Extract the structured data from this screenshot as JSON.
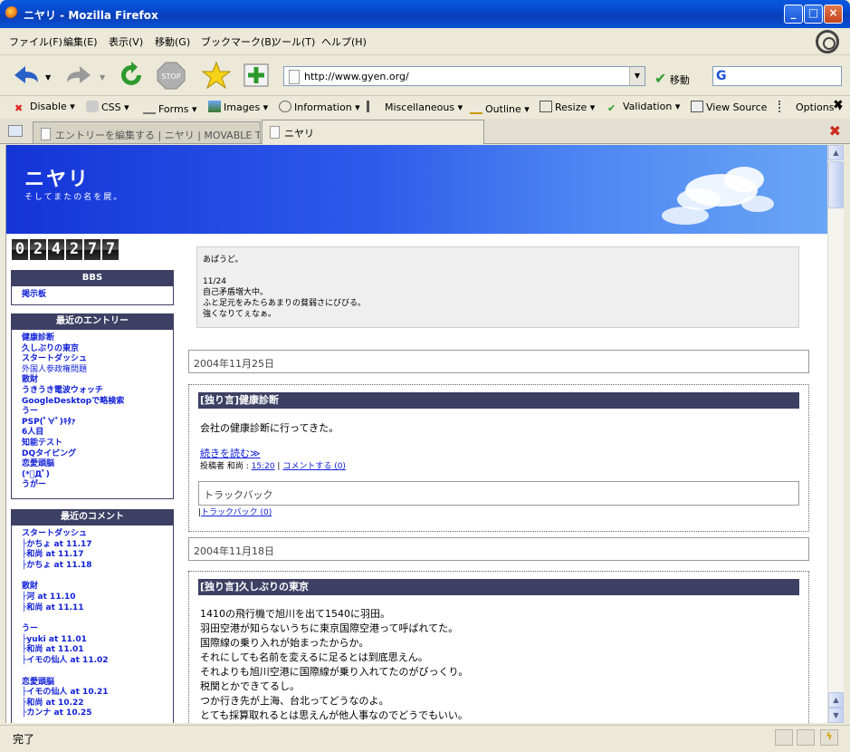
{
  "window": {
    "title": "ニヤリ - Mozilla Firefox"
  },
  "menu": [
    "ファイル(F)",
    "編集(E)",
    "表示(V)",
    "移動(G)",
    "ブックマーク(B)",
    "ツール(T)",
    "ヘルプ(H)"
  ],
  "nav": {
    "url": "http://www.gyen.org/",
    "go_label": "移動",
    "search_value": ""
  },
  "devbar": [
    "Disable",
    "CSS",
    "Forms",
    "Images",
    "Information",
    "Miscellaneous",
    "Outline",
    "Resize",
    "Validation",
    "View Source",
    "Options"
  ],
  "tabs": [
    {
      "label": "エントリーを編集する | ニヤリ | MOVABLE T..."
    },
    {
      "label": "ニヤリ"
    }
  ],
  "blog": {
    "title": "ニヤリ",
    "subtitle": "そしてまたの名を屍。",
    "counter": [
      "0",
      "2",
      "4",
      "2",
      "7",
      "7"
    ]
  },
  "sidebar": {
    "bbs": {
      "header": "BBS",
      "items": [
        "掲示板"
      ]
    },
    "recent_entries": {
      "header": "最近のエントリー",
      "items": [
        "健康診断",
        "久しぶりの東京",
        "スタートダッシュ",
        "外国人参政権問題",
        "散財",
        "うきうき電波ウォッチ",
        "GoogleDesktopで略検索",
        "うー",
        "PSP(ﾟ∀ﾟ)ｷﾀｧ",
        "6人目",
        "知能テスト",
        "DQタイピング",
        "恋愛頭脳",
        "(*ﾟДﾟ)",
        "うがー"
      ]
    },
    "recent_comments": {
      "header": "最近のコメント",
      "groups": [
        {
          "title": "スタートダッシュ",
          "items": [
            "├かちょ at 11.17",
            "├和尚 at 11.17",
            "├かちょ at 11.18"
          ]
        },
        {
          "title": "散財",
          "items": [
            "├河 at 11.10",
            "├和尚 at 11.11"
          ]
        },
        {
          "title": "うー",
          "items": [
            "├yuki at 11.01",
            "├和尚 at 11.01",
            "├イモの仙人 at 11.02"
          ]
        },
        {
          "title": "恋愛頭脳",
          "items": [
            "├イモの仙人 at 10.21",
            "├和尚 at 10.22",
            "├カンナ at 10.25"
          ]
        }
      ]
    }
  },
  "intro": {
    "lines": [
      "あぱうど。",
      "",
      "11/24",
      "自己矛盾増大中。",
      "ふと足元をみたらあまりの貧弱さにびびる。",
      "強くなりてぇなぁ。"
    ]
  },
  "main": {
    "date1": "2004年11月25日",
    "entry1": {
      "title": "[独り言]健康診断",
      "body": "会社の健康診断に行ってきた。",
      "more": "続きを読む≫",
      "meta_prefix": "投稿者 和尚 : ",
      "time": "15:20",
      "sep": " | ",
      "comment": "コメントする (0)",
      "trackback_header": "トラックバック",
      "trackback_prefix": "|",
      "trackback_link": "トラックバック (0)"
    },
    "date2": "2004年11月18日",
    "entry2": {
      "title": "[独り言]久しぶりの東京",
      "lines": [
        "1410の飛行機で旭川を出て1540に羽田。",
        "羽田空港が知らないうちに東京国際空港って呼ばれてた。",
        "国際線の乗り入れが始まったからか。",
        "それにしても名前を変えるに足るとは到底思えん。",
        "それよりも旭川空港に国際線が乗り入れてたのがびっくり。",
        "税関とかできてるし。",
        "つか行き先が上海、台北ってどうなのよ。",
        "とても採算取れるとは思えんが他人事なのでどうでもいい。"
      ]
    }
  },
  "status": {
    "text": "完了"
  }
}
